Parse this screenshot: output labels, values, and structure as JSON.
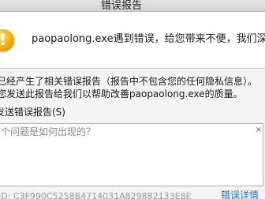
{
  "window": {
    "title": "错误报告"
  },
  "header": {
    "message": "paopaolong.exe遇到错误，给您带来不便，我们深表歉",
    "icon": "warning-icon"
  },
  "info": {
    "line1": "已经产生了相关错误报告（报告中不包含您的任何隐私信息）。",
    "line2": "您发送此报告给我们以帮助改善paopaolong.exe的质量。"
  },
  "send_report": {
    "label": "发送错误报告(S)"
  },
  "description": {
    "placeholder": "个问题是如何出现的？",
    "close_glyph": "×"
  },
  "footer": {
    "report_id": "ID: C3F990C5258B4714031A829882133E8E",
    "link_text": "错误详情"
  }
}
